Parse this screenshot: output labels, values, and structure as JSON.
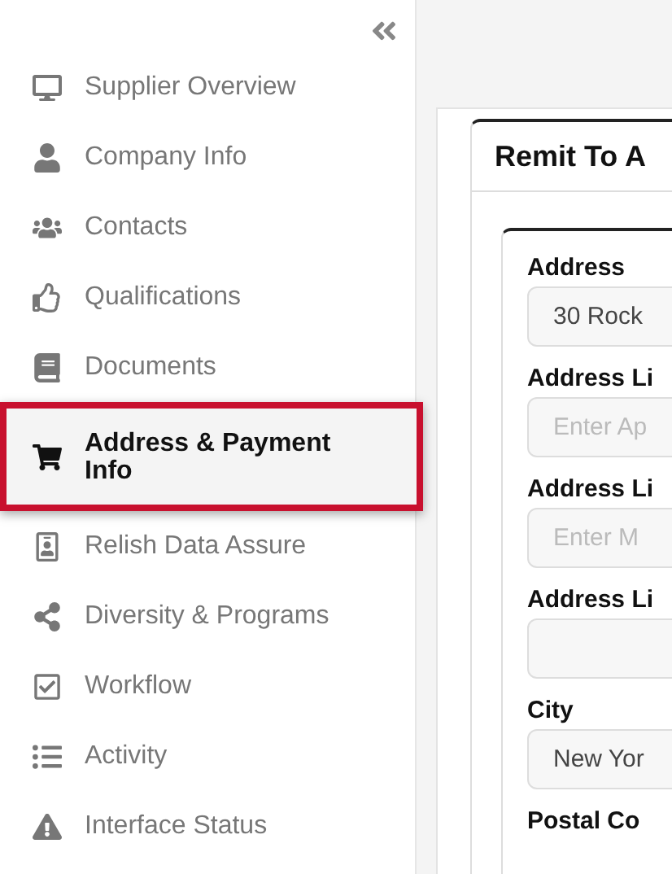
{
  "sidebar": {
    "items": [
      {
        "label": "Supplier Overview",
        "selected": false
      },
      {
        "label": "Company Info",
        "selected": false
      },
      {
        "label": "Contacts",
        "selected": false
      },
      {
        "label": "Qualifications",
        "selected": false
      },
      {
        "label": "Documents",
        "selected": false
      },
      {
        "label": "Address & Payment Info",
        "selected": true
      },
      {
        "label": "Relish Data Assure",
        "selected": false
      },
      {
        "label": "Diversity & Programs",
        "selected": false
      },
      {
        "label": "Workflow",
        "selected": false
      },
      {
        "label": "Activity",
        "selected": false
      },
      {
        "label": "Interface Status",
        "selected": false
      }
    ]
  },
  "panel": {
    "title": "Remit To A",
    "fields": [
      {
        "label": "Address",
        "value": "30 Rock"
      },
      {
        "label": "Address Li",
        "placeholder": "Enter Ap"
      },
      {
        "label": "Address Li",
        "placeholder": "Enter M"
      },
      {
        "label": "Address Li"
      },
      {
        "label": "City",
        "value": "New Yor"
      },
      {
        "label": "Postal Co"
      }
    ]
  }
}
